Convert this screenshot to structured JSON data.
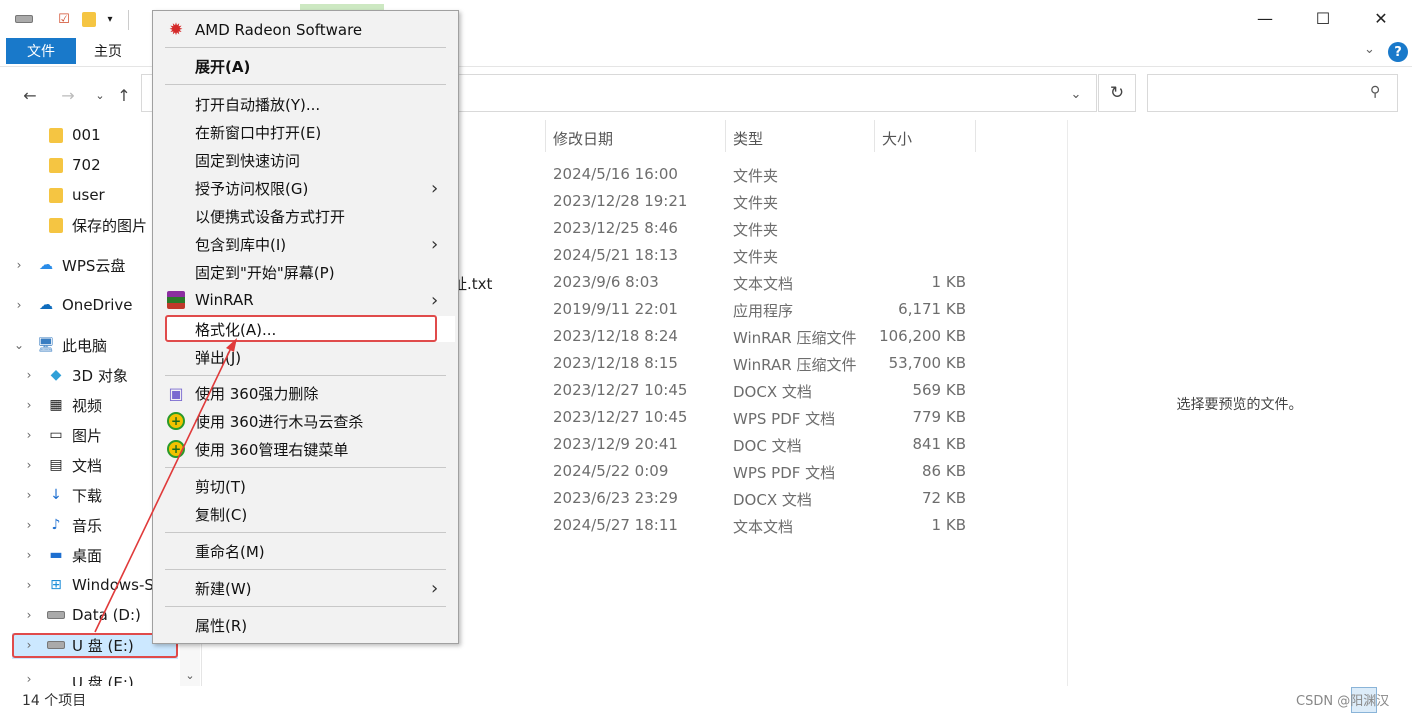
{
  "ribbon": {
    "file_tab": "文件",
    "home_tab": "主页"
  },
  "window": {
    "minimize": "—",
    "maximize": "☐",
    "close": "✕"
  },
  "sidebar": {
    "items": [
      {
        "label": "001",
        "icon": "folder-icon"
      },
      {
        "label": "702",
        "icon": "folder-icon"
      },
      {
        "label": "user",
        "icon": "folder-icon"
      },
      {
        "label": "保存的图片",
        "icon": "folder-icon"
      },
      {
        "label": "WPS云盘",
        "icon": "cloud-icon"
      },
      {
        "label": "OneDrive",
        "icon": "onedrive-icon"
      },
      {
        "label": "此电脑",
        "icon": "computer-icon"
      },
      {
        "label": "3D 对象",
        "icon": "cube-icon"
      },
      {
        "label": "视频",
        "icon": "video-icon"
      },
      {
        "label": "图片",
        "icon": "picture-icon"
      },
      {
        "label": "文档",
        "icon": "document-icon"
      },
      {
        "label": "下载",
        "icon": "download-icon"
      },
      {
        "label": "音乐",
        "icon": "music-icon"
      },
      {
        "label": "桌面",
        "icon": "desktop-icon"
      },
      {
        "label": "Windows-S",
        "icon": "windows-drive-icon"
      },
      {
        "label": "Data (D:)",
        "icon": "drive-icon"
      },
      {
        "label": "U 盘 (E:)",
        "icon": "usb-drive-icon"
      },
      {
        "label": "U 盘 (E:)",
        "icon": "usb-drive-icon"
      }
    ]
  },
  "columns": {
    "date": "修改日期",
    "type": "类型",
    "size": "大小"
  },
  "partial_name": "址.txt",
  "files": [
    {
      "date": "2024/5/16 16:00",
      "type": "文件夹",
      "size": ""
    },
    {
      "date": "2023/12/28 19:21",
      "type": "文件夹",
      "size": ""
    },
    {
      "date": "2023/12/25 8:46",
      "type": "文件夹",
      "size": ""
    },
    {
      "date": "2024/5/21 18:13",
      "type": "文件夹",
      "size": ""
    },
    {
      "date": "2023/9/6 8:03",
      "type": "文本文档",
      "size": "1 KB"
    },
    {
      "date": "2019/9/11 22:01",
      "type": "应用程序",
      "size": "6,171 KB"
    },
    {
      "date": "2023/12/18 8:24",
      "type": "WinRAR 压缩文件",
      "size": "106,200 KB"
    },
    {
      "date": "2023/12/18 8:15",
      "type": "WinRAR 压缩文件",
      "size": "53,700 KB"
    },
    {
      "date": "2023/12/27 10:45",
      "type": "DOCX 文档",
      "size": "569 KB"
    },
    {
      "date": "2023/12/27 10:45",
      "type": "WPS PDF 文档",
      "size": "779 KB"
    },
    {
      "date": "2023/12/9 20:41",
      "type": "DOC 文档",
      "size": "841 KB"
    },
    {
      "date": "2024/5/22 0:09",
      "type": "WPS PDF 文档",
      "size": "86 KB"
    },
    {
      "date": "2023/6/23 23:29",
      "type": "DOCX 文档",
      "size": "72 KB"
    },
    {
      "date": "2024/5/27 18:11",
      "type": "文本文档",
      "size": "1 KB"
    }
  ],
  "preview": {
    "message": "选择要预览的文件。"
  },
  "status": {
    "count": "14 个项目"
  },
  "watermark": "CSDN @阳渊汉",
  "context_menu": {
    "amd": "AMD Radeon Software",
    "expand": "展开(A)",
    "autoplay": "打开自动播放(Y)...",
    "new_window": "在新窗口中打开(E)",
    "pin_quick": "固定到快速访问",
    "grant_access": "授予访问权限(G)",
    "portable": "以便携式设备方式打开",
    "include_library": "包含到库中(I)",
    "pin_start": "固定到\"开始\"屏幕(P)",
    "winrar": "WinRAR",
    "format": "格式化(A)...",
    "eject": "弹出(J)",
    "del360": "使用 360强力删除",
    "scan360": "使用 360进行木马云查杀",
    "manage360": "使用 360管理右键菜单",
    "cut": "剪切(T)",
    "copy": "复制(C)",
    "rename": "重命名(M)",
    "new": "新建(W)",
    "properties": "属性(R)"
  }
}
